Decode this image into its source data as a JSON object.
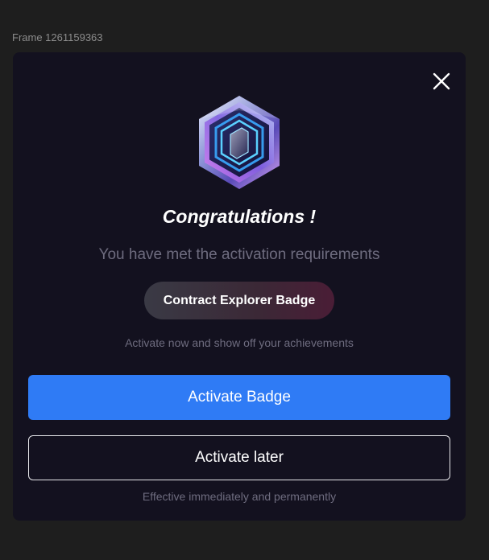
{
  "frame": {
    "label": "Frame 1261159363"
  },
  "dialog": {
    "close_icon": "close-icon",
    "badge_icon": "hexagon-badge-icon",
    "title": "Congratulations !",
    "subtitle": "You have met the activation requirements",
    "badge_name": "Contract Explorer Badge",
    "hint": "Activate now and show off your achievements",
    "primary_button": "Activate Badge",
    "secondary_button": "Activate later",
    "footer_note": "Effective immediately and permanently"
  },
  "colors": {
    "background": "#1e1e1e",
    "modal": "#13111f",
    "primary": "#2f7bf5",
    "muted_text": "#6e6c7f",
    "badge_accent": "#4a1d36"
  }
}
